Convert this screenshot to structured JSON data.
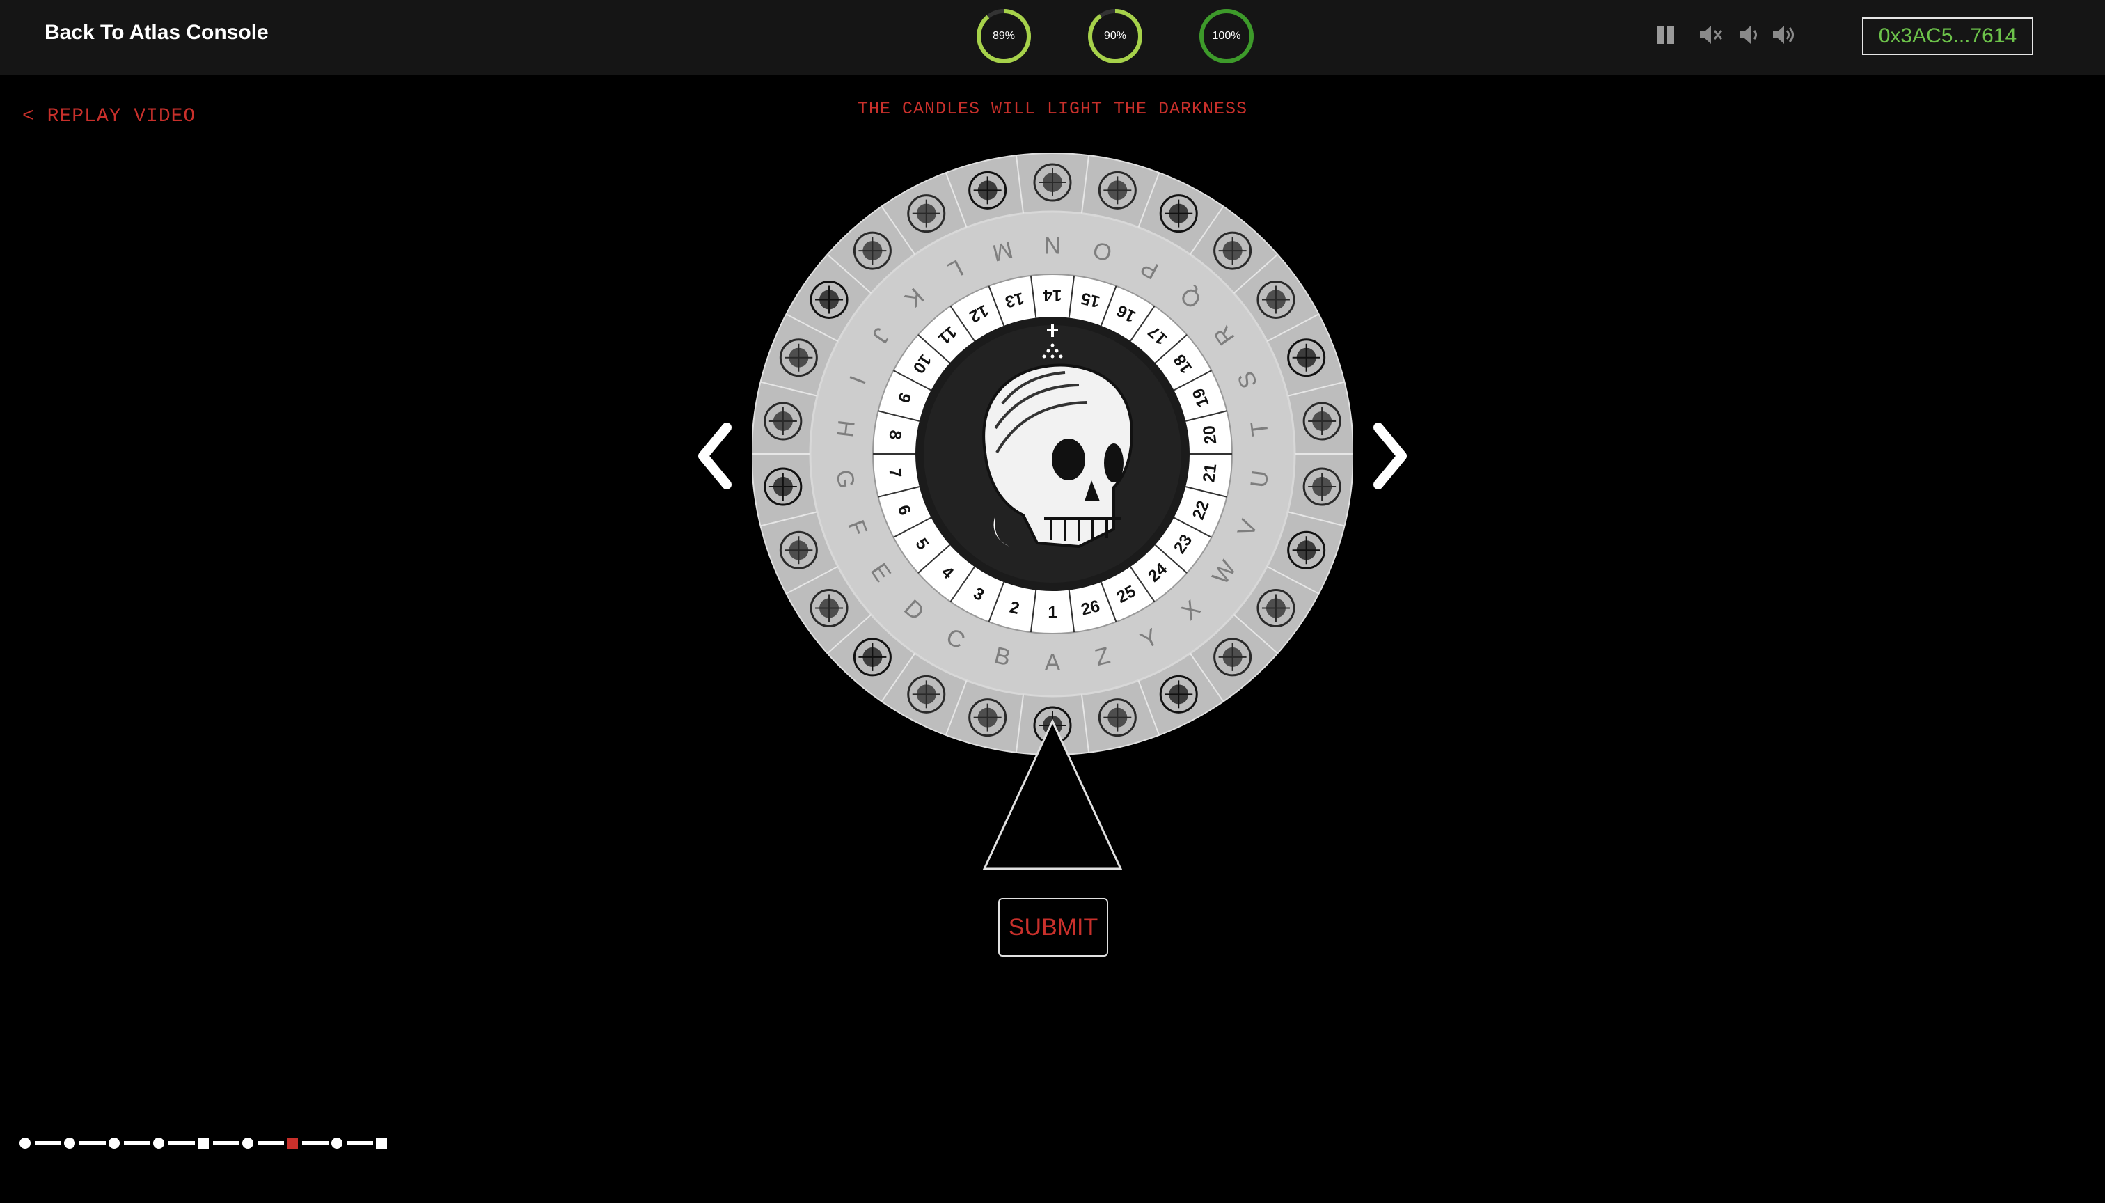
{
  "header": {
    "back_label": "Back To Atlas Console",
    "meters": [
      {
        "label": "89%",
        "value": 0.89,
        "color": "#a6d14a"
      },
      {
        "label": "90%",
        "value": 0.9,
        "color": "#a6d14a"
      },
      {
        "label": "100%",
        "value": 1.0,
        "color": "#3d9a2a"
      }
    ],
    "audio_controls": [
      "pause-icon",
      "mute-icon",
      "volume-low-icon",
      "volume-high-icon"
    ],
    "wallet": "0x3AC5...7614"
  },
  "replay_label": "< REPLAY VIDEO",
  "caption": "THE CANDLES WILL LIGHT THE DARKNESS",
  "wheel": {
    "letters": [
      "A",
      "B",
      "C",
      "D",
      "E",
      "F",
      "G",
      "H",
      "I",
      "J",
      "K",
      "L",
      "M",
      "N",
      "O",
      "P",
      "Q",
      "R",
      "S",
      "T",
      "U",
      "V",
      "W",
      "X",
      "Y",
      "Z"
    ],
    "numbers": [
      "1",
      "2",
      "3",
      "4",
      "5",
      "6",
      "7",
      "8",
      "9",
      "10",
      "11",
      "12",
      "13",
      "14",
      "15",
      "16",
      "17",
      "18",
      "19",
      "20",
      "21",
      "22",
      "23",
      "24",
      "25",
      "26"
    ],
    "symbols": [
      "circle-eye-symbol",
      "trefoil-symbol",
      "serpent-symbol",
      "molecule-symbol",
      "icosahedron-symbol",
      "jellyfish-symbol",
      "brain-symbol",
      "key-symbol",
      "hand-symbol",
      "scorpion-symbol",
      "droplets-symbol",
      "triangle-sun-symbol",
      "flower-of-life-symbol",
      "globe-symbol",
      "airplane-symbol",
      "tree-symbol",
      "atom-symbol",
      "pyramid-symbol",
      "vitruvian-symbol",
      "dodecahedron-symbol",
      "shell-symbol",
      "octahedron-symbol",
      "sphere-symbol",
      "griffin-symbol",
      "coral-symbol",
      "star-polyhedron-symbol"
    ],
    "center": "skull-emblem"
  },
  "submit_label": "SUBMIT",
  "progress": {
    "steps": [
      "circle",
      "dash",
      "circle",
      "dash",
      "circle",
      "dash",
      "circle",
      "dash",
      "square",
      "dash",
      "circle",
      "dash",
      "square-active",
      "dash",
      "circle",
      "dash",
      "square"
    ]
  },
  "colors": {
    "accent": "#c8302b",
    "wallet_text": "#6cc24a",
    "topbar": "#151515"
  }
}
